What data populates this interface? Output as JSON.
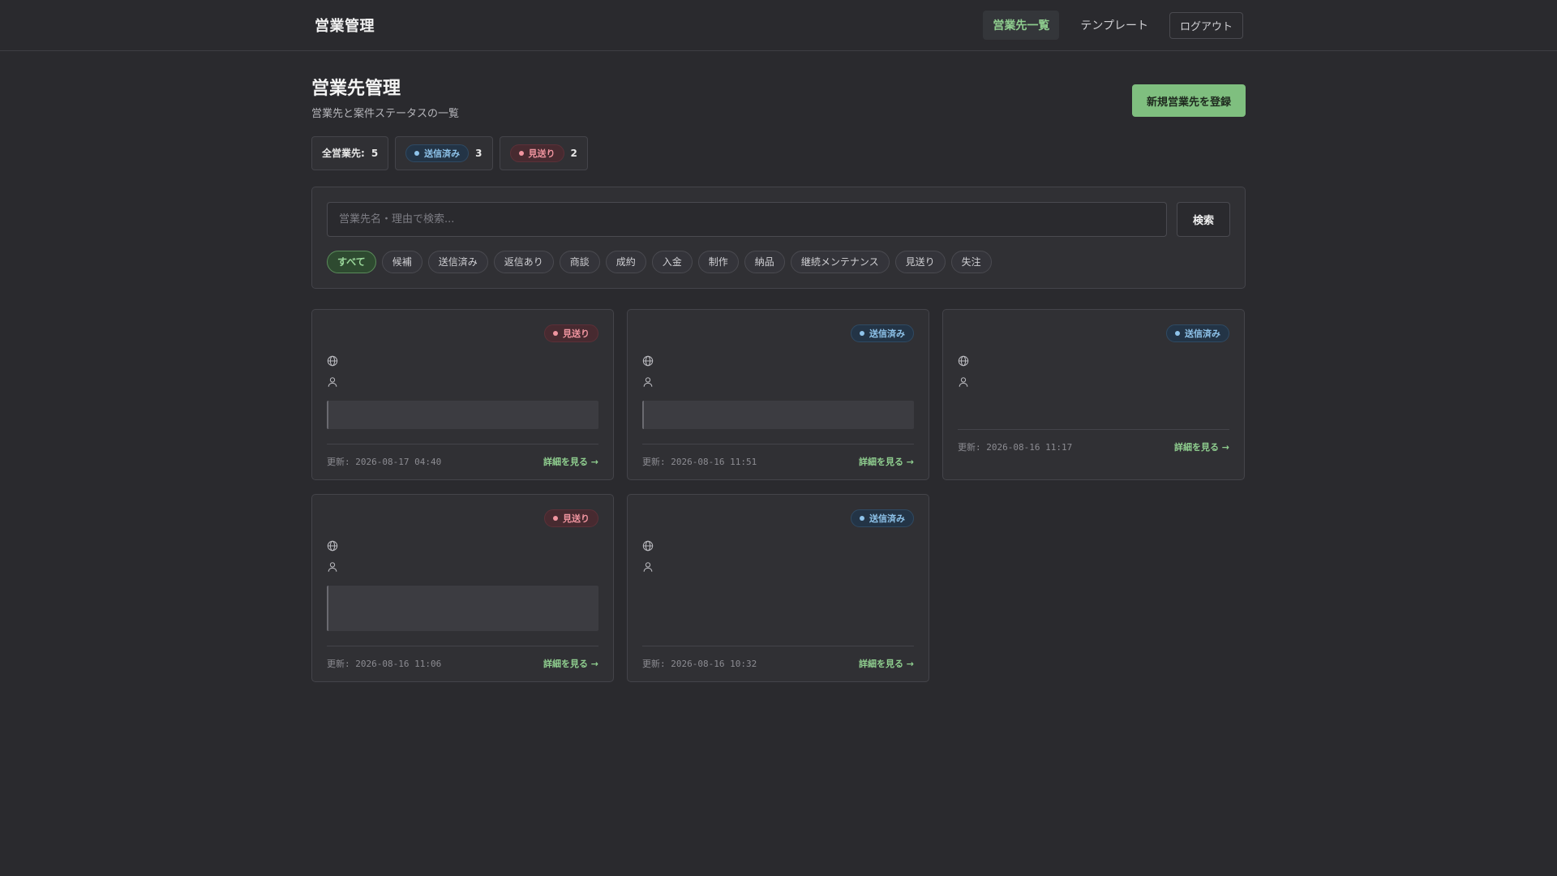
{
  "header": {
    "brand": "営業管理",
    "nav": [
      {
        "label": "営業先一覧",
        "active": true
      },
      {
        "label": "テンプレート",
        "active": false
      },
      {
        "label": "ログアウト",
        "active": false
      }
    ]
  },
  "page": {
    "title": "営業先管理",
    "subtitle": "営業先と案件ステータスの一覧",
    "new_button": "新規営業先を登録"
  },
  "stats": {
    "total_label": "全営業先:",
    "total_value": "5",
    "sent_label": "送信済み",
    "sent_value": "3",
    "drop_label": "見送り",
    "drop_value": "2"
  },
  "search": {
    "placeholder": "営業先名・理由で検索...",
    "button": "検索"
  },
  "filters": [
    "すべて",
    "候補",
    "送信済み",
    "返信あり",
    "商談",
    "成約",
    "入金",
    "制作",
    "納品",
    "継続メンテナンス",
    "見送り",
    "失注"
  ],
  "cards": [
    {
      "status": "見送り",
      "updated": "更新: 2026-08-17 04:40",
      "link": "詳細を見る →"
    },
    {
      "status": "送信済み",
      "updated": "更新: 2026-08-16 11:51",
      "link": "詳細を見る →"
    },
    {
      "status": "送信済み",
      "updated": "更新: 2026-08-16 11:17",
      "link": "詳細を見る →"
    },
    {
      "status": "見送り",
      "updated": "更新: 2026-08-16 11:06",
      "link": "詳細を見る →"
    },
    {
      "status": "送信済み",
      "updated": "更新: 2026-08-16 10:32",
      "link": "詳細を見る →"
    }
  ],
  "colors": {
    "background": "#2a2a2e",
    "accent_green": "#7fbf7f",
    "status_sent": "#8ec3ea",
    "status_drop": "#f0949f"
  }
}
